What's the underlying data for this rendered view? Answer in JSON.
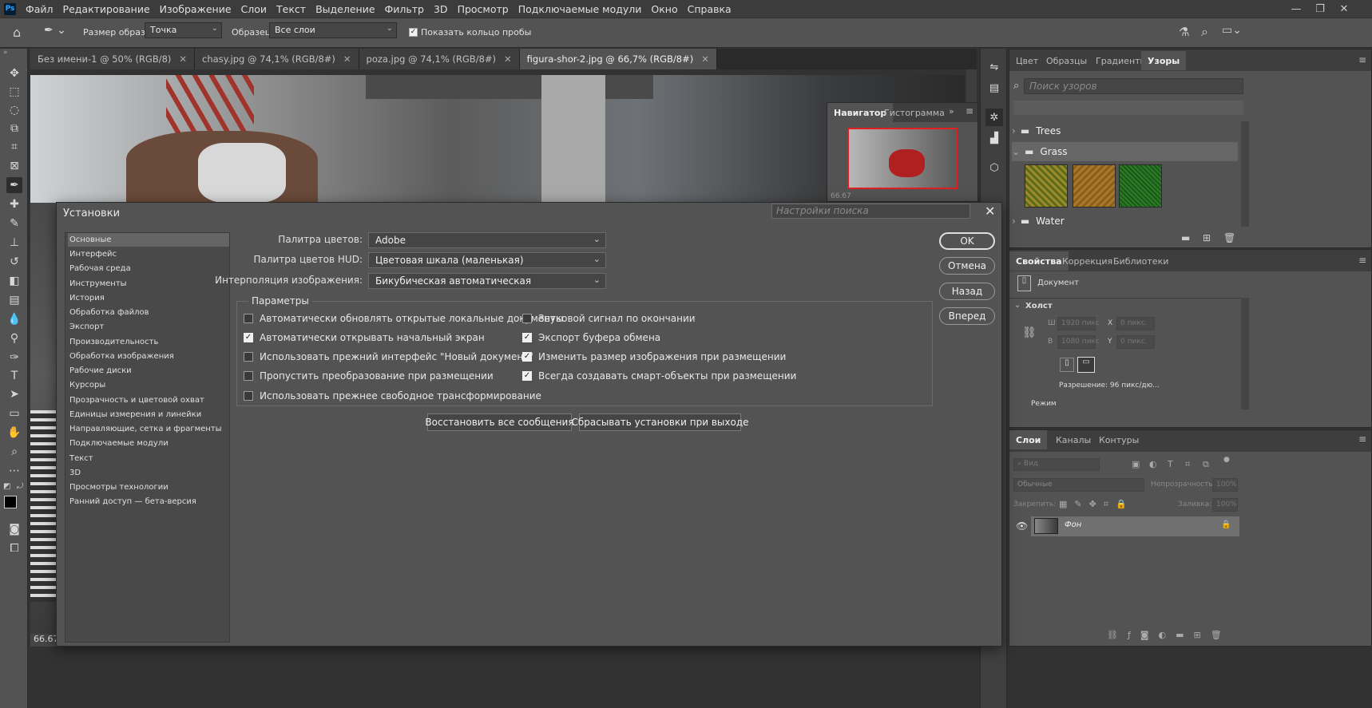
{
  "menubar": {
    "logo": "Ps",
    "items": [
      "Файл",
      "Редактирование",
      "Изображение",
      "Слои",
      "Текст",
      "Выделение",
      "Фильтр",
      "3D",
      "Просмотр",
      "Подключаемые модули",
      "Окно",
      "Справка"
    ]
  },
  "options": {
    "sample_size_label": "Размер образца:",
    "sample_size_value": "Точка",
    "sample_label": "Образец:",
    "sample_value": "Все слои",
    "show_ring_label": "Показать кольцо пробы"
  },
  "tabs": [
    {
      "label": "Без имени-1 @ 50% (RGB/8)"
    },
    {
      "label": "chasy.jpg @ 74,1% (RGB/8#)"
    },
    {
      "label": "poza.jpg @ 74,1% (RGB/8#)"
    },
    {
      "label": "figura-shor-2.jpg @ 66,7% (RGB/8#)"
    }
  ],
  "status": {
    "zoom": "66.67"
  },
  "navigator": {
    "tab1": "Навигатор",
    "tab2": "Гистограмма",
    "zoom": "66.67"
  },
  "patterns_panel": {
    "tabs": [
      "Цвет",
      "Образцы",
      "Градиенты",
      "Узоры"
    ],
    "search_placeholder": "Поиск узоров",
    "groups": [
      {
        "name": "Trees"
      },
      {
        "name": "Grass"
      },
      {
        "name": "Water"
      }
    ],
    "swatch_colors": [
      "#9a8a2a",
      "#a8782a",
      "#2e7a28"
    ]
  },
  "properties_panel": {
    "tabs": [
      "Свойства",
      "Коррекция",
      "Библиотеки"
    ],
    "doc_label": "Документ",
    "canvas_label": "Холст",
    "w_label": "Ш",
    "h_label": "В",
    "x_label": "X",
    "y_label": "Y",
    "w_value": "1920 пикс",
    "h_value": "1080 пикс",
    "x_value": "0 пикс.",
    "y_value": "0 пикс.",
    "resolution": "Разрешение: 96 пикс/дю...",
    "mode_label": "Режим"
  },
  "layers_panel": {
    "tabs": [
      "Слои",
      "Каналы",
      "Контуры"
    ],
    "filter_placeholder": "Вид",
    "blend_mode": "Обычные",
    "opacity_label": "Непрозрачность:",
    "opacity_value": "100%",
    "lock_label": "Закрепить:",
    "fill_label": "Заливка:",
    "fill_value": "100%",
    "layer_name": "Фон"
  },
  "dialog": {
    "title": "Установки",
    "search_placeholder": "Настройки поиска",
    "categories": [
      "Основные",
      "Интерфейс",
      "Рабочая среда",
      "Инструменты",
      "История",
      "Обработка файлов",
      "Экспорт",
      "Производительность",
      "Обработка изображения",
      "Рабочие диски",
      "Курсоры",
      "Прозрачность и цветовой охват",
      "Единицы измерения и линейки",
      "Направляющие, сетка и фрагменты",
      "Подключаемые модули",
      "Текст",
      "3D",
      "Просмотры технологии",
      "Ранний доступ — бета-версия"
    ],
    "color_picker_label": "Палитра цветов:",
    "color_picker_value": "Adobe",
    "hud_picker_label": "Палитра цветов HUD:",
    "hud_picker_value": "Цветовая шкала (маленькая)",
    "interp_label": "Интерполяция изображения:",
    "interp_value": "Бикубическая автоматическая",
    "group_title": "Параметры",
    "options_left": [
      {
        "label": "Автоматически обновлять открытые локальные документы",
        "checked": false
      },
      {
        "label": "Автоматически открывать начальный экран",
        "checked": true
      },
      {
        "label": "Использовать прежний интерфейс \"Новый документ\"",
        "checked": false
      },
      {
        "label": "Пропустить преобразование при размещении",
        "checked": false
      },
      {
        "label": "Использовать прежнее свободное трансформирование",
        "checked": false
      }
    ],
    "options_right": [
      {
        "label": "Звуковой сигнал по окончании",
        "checked": false
      },
      {
        "label": "Экспорт буфера обмена",
        "checked": true
      },
      {
        "label": "Изменить размер изображения при размещении",
        "checked": true
      },
      {
        "label": "Всегда создавать смарт-объекты при размещении",
        "checked": true
      }
    ],
    "reset_messages": "Восстановить все сообщения",
    "reset_on_exit": "Сбрасывать установки при выходе",
    "ok": "OK",
    "cancel": "Отмена",
    "prev": "Назад",
    "next": "Вперед"
  }
}
